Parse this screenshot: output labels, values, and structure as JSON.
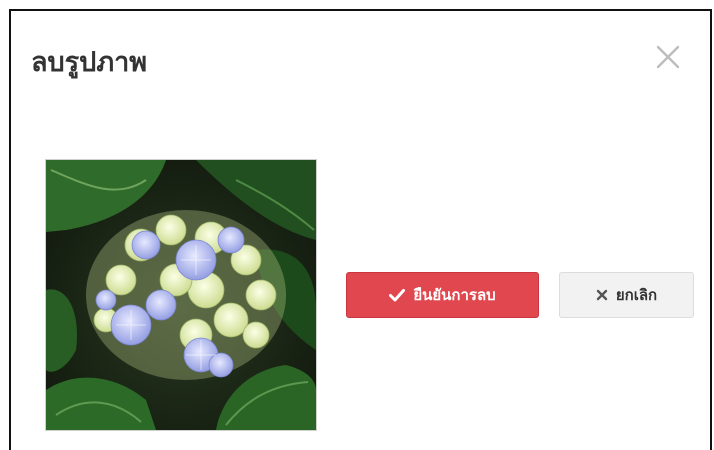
{
  "dialog": {
    "title": "ลบรูปภาพ",
    "close_icon": "close-icon"
  },
  "image": {
    "subject": "hydrangea-flower-photo",
    "icon": "photo-thumbnail"
  },
  "buttons": {
    "confirm_label": "ยืนยันการลบ",
    "confirm_icon": "check-icon",
    "confirm_color": "#e0474f",
    "cancel_label": "ยกเลิก",
    "cancel_icon": "times-icon",
    "cancel_color": "#f2f2f2"
  }
}
